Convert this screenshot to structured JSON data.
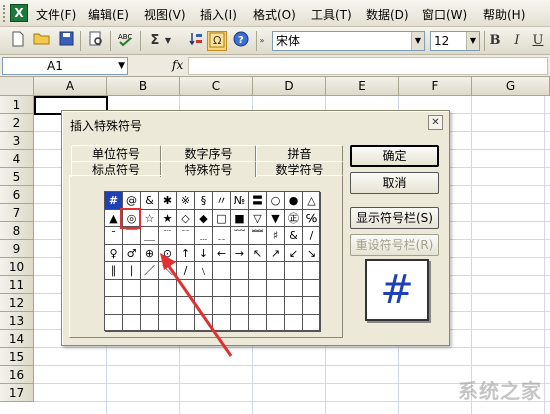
{
  "menubar": {
    "icon_glyph": "X",
    "items": [
      "文件(F)",
      "编辑(E)",
      "视图(V)",
      "插入(I)",
      "格式(O)",
      "工具(T)",
      "数据(D)",
      "窗口(W)",
      "帮助(H)"
    ]
  },
  "toolbar": {
    "icons": [
      "new-icon",
      "open-icon",
      "save-icon",
      "print-preview-icon",
      "spelling-icon",
      "autosum-icon",
      "sort-icon",
      "special-symbol-icon",
      "help-icon"
    ],
    "sigma_glyph": "Σ",
    "font_name": "宋体",
    "font_size": "12",
    "bold_label": "B",
    "italic_label": "I",
    "underline_label": "U"
  },
  "formula_bar": {
    "name_box": "A1",
    "fx_label": "fx",
    "value": ""
  },
  "sheet": {
    "columns": [
      "A",
      "B",
      "C",
      "D",
      "E",
      "F",
      "G"
    ],
    "rows": [
      "1",
      "2",
      "3",
      "4",
      "5",
      "6",
      "7",
      "8",
      "9",
      "10",
      "11",
      "12",
      "13",
      "14",
      "15",
      "16",
      "17"
    ]
  },
  "dialog": {
    "title": "插入特殊符号",
    "close_glyph": "✕",
    "tabs_back": [
      "单位符号",
      "数字序号",
      "拼音"
    ],
    "tabs_front": [
      "标点符号",
      "特殊符号",
      "数学符号"
    ],
    "selected_tab": "特殊符号",
    "symbols": [
      "#",
      "@",
      "&",
      "✱",
      "※",
      "§",
      "〃",
      "№",
      "〓",
      "○",
      "●",
      "△",
      "▲",
      "◎",
      "☆",
      "★",
      "◇",
      "◆",
      "□",
      "■",
      "▽",
      "▼",
      "㊣",
      "℅",
      "ˉ",
      "￣",
      "＿",
      "﹉",
      "﹊",
      "﹍",
      "﹎",
      "﹋",
      "﹌",
      "♯",
      "&",
      "/",
      "♀",
      "♂",
      "⊕",
      "⊙",
      "↑",
      "↓",
      "←",
      "→",
      "↖",
      "↗",
      "↙",
      "↘",
      "∥",
      "∣",
      "／",
      "＼",
      "∕",
      "﹨",
      "",
      "",
      "",
      "",
      "",
      "",
      "",
      "",
      "",
      "",
      "",
      "",
      "",
      "",
      "",
      "",
      "",
      "",
      "",
      "",
      "",
      "",
      "",
      "",
      "",
      "",
      "",
      "",
      "",
      "",
      "",
      "",
      "",
      "",
      "",
      "",
      "",
      "",
      "",
      "",
      "",
      ""
    ],
    "buttons": {
      "ok": "确定",
      "cancel": "取消",
      "show_toolbar": "显示符号栏(S)",
      "reset_toolbar": "重设符号栏(R)"
    },
    "preview_symbol": "#"
  },
  "watermark": "系统之家",
  "colors": {
    "highlight": "#1f3fb5",
    "annotation": "#e03030"
  }
}
